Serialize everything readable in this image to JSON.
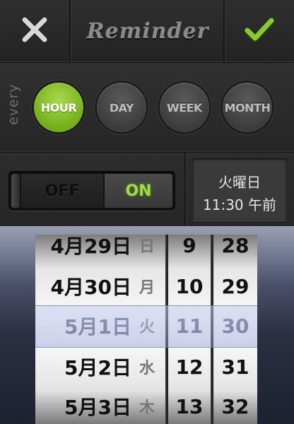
{
  "header": {
    "title": "Reminder",
    "close_icon": "close-icon",
    "save_icon": "checkmark-icon"
  },
  "frequency": {
    "label": "every",
    "options": [
      "HOUR",
      "DAY",
      "WEEK",
      "MONTH"
    ],
    "selected": "HOUR"
  },
  "toggle": {
    "off_label": "OFF",
    "on_label": "ON",
    "state": "ON"
  },
  "time_display": {
    "weekday": "火曜日",
    "time": "11:30 午前"
  },
  "picker": {
    "dates": [
      {
        "md": "4月29日",
        "dow": "日"
      },
      {
        "md": "4月30日",
        "dow": "月"
      },
      {
        "md": "5月1日",
        "dow": "火"
      },
      {
        "md": "5月2日",
        "dow": "水"
      },
      {
        "md": "5月3日",
        "dow": "木"
      }
    ],
    "hours": [
      "9",
      "10",
      "11",
      "12",
      "13"
    ],
    "minutes": [
      "28",
      "29",
      "30",
      "31",
      "32"
    ],
    "selected_index": 2
  },
  "colors": {
    "accent_green": "#8bc832",
    "on_text": "#9ee03a"
  }
}
